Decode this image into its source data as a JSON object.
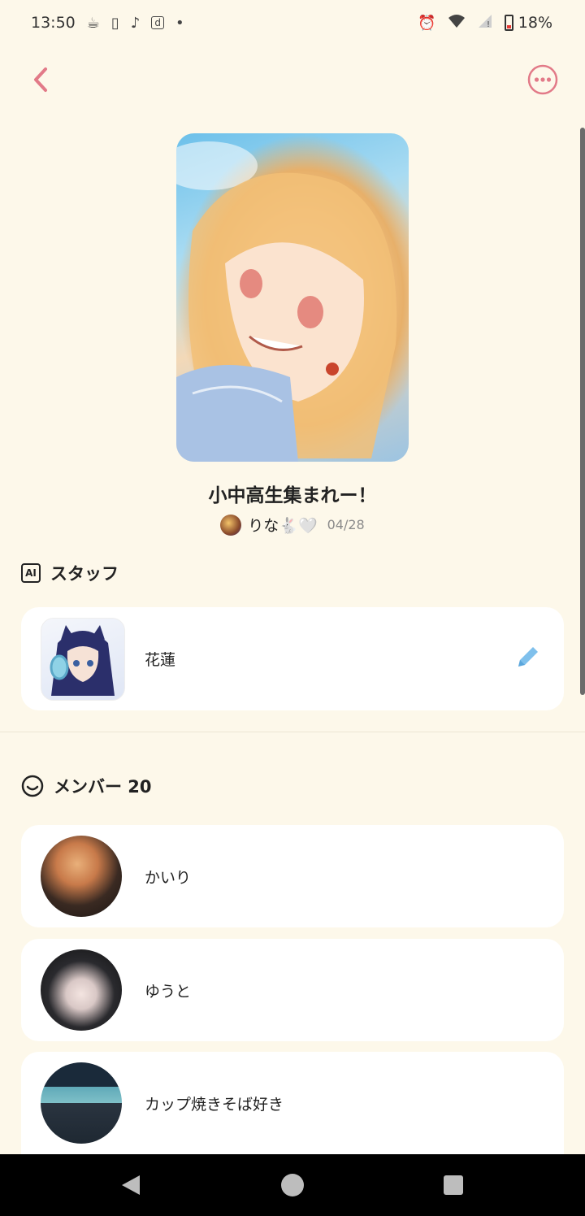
{
  "status_bar": {
    "time": "13:50",
    "notification_icons": [
      "cup-icon",
      "vibrate-icon",
      "tiktok-icon",
      "d-app-icon",
      "dot-icon"
    ],
    "battery": "18%",
    "system_icons": [
      "alarm-icon",
      "wifi-icon",
      "signal-icon",
      "battery-icon"
    ]
  },
  "header": {
    "back_icon": "chevron-left-icon",
    "more_icon": "more-horizontal-icon",
    "accent_color": "#e27a88"
  },
  "group": {
    "title": "小中高生集まれー！",
    "owner_name": "りな🐇🤍",
    "date": "04/28"
  },
  "staff_section": {
    "label": "スタッフ",
    "icon": "ai-icon",
    "items": [
      {
        "name": "花蓮",
        "edit_icon": "pencil-icon"
      }
    ]
  },
  "member_section": {
    "label": "メンバー 20",
    "icon": "smile-icon",
    "items": [
      {
        "name": "かいり"
      },
      {
        "name": "ゆうと"
      },
      {
        "name": "カップ焼きそば好き"
      }
    ]
  },
  "nav_bar": {
    "back": "triangle-back-icon",
    "home": "circle-home-icon",
    "recent": "square-recents-icon"
  }
}
